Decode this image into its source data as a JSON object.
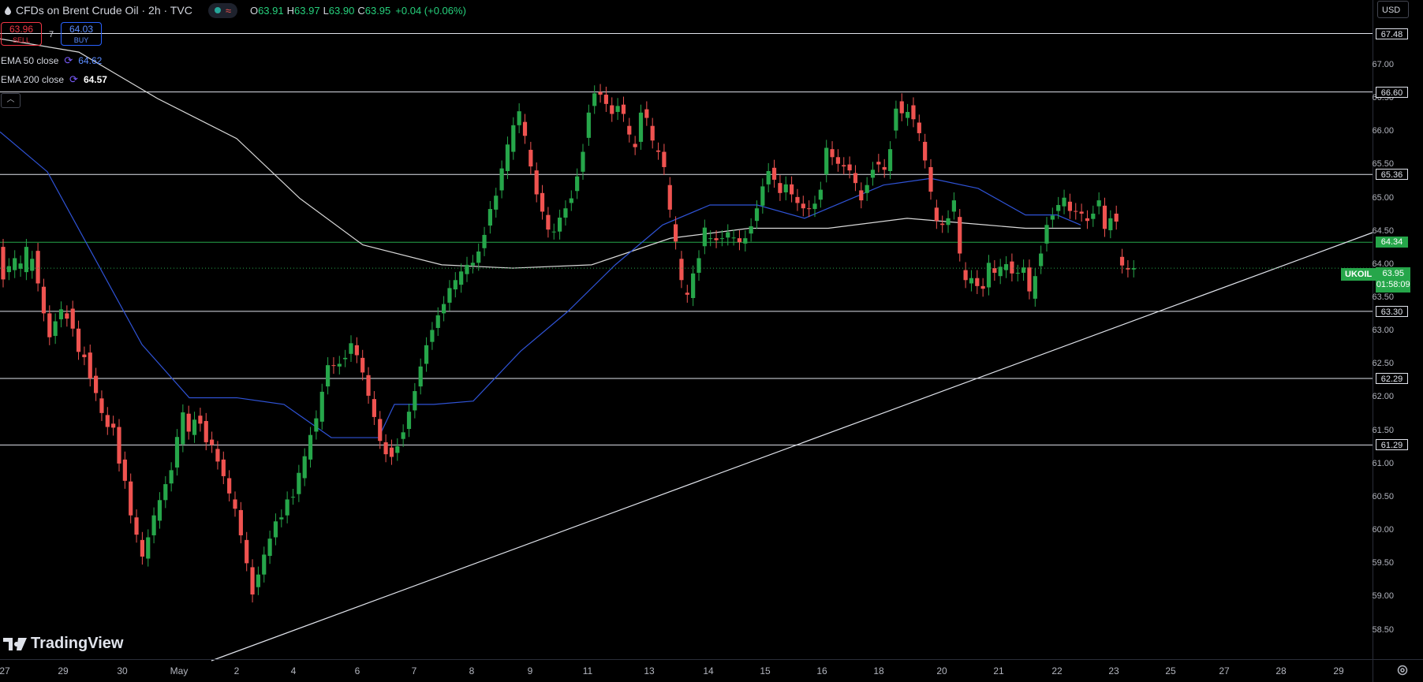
{
  "header": {
    "title": "CFDs on Brent Crude Oil · 2h · TVC",
    "ohlc": {
      "o_label": "O",
      "o": "63.91",
      "h_label": "H",
      "h": "63.97",
      "l_label": "L",
      "l": "63.90",
      "c_label": "C",
      "c": "63.95",
      "change": "+0.04 (+0.06%)"
    }
  },
  "trade": {
    "sell_price": "63.96",
    "sell_label": "SELL",
    "spread": "7",
    "buy_price": "64.03",
    "buy_label": "BUY"
  },
  "indicators": [
    {
      "label": "EMA 50 close",
      "value": "64.62"
    },
    {
      "label": "EMA 200 close",
      "value": "64.57"
    }
  ],
  "currency": "USD",
  "symbol_tag": {
    "symbol": "UKOIL",
    "price": "63.95",
    "countdown": "01:58:09"
  },
  "logo_text": "TradingView",
  "colors": {
    "up": "#26a64a",
    "down": "#ef5350",
    "ema50": "#2f53d6",
    "ema200": "#d9d9d9",
    "level": "#e0e3eb",
    "accent_level": "#26a64a"
  },
  "icons": [
    "drop-icon",
    "status-dot-icon",
    "wave-icon",
    "refresh-icon",
    "chevron-up-icon",
    "tradingview-logo-icon",
    "gear-icon"
  ],
  "chart_data": {
    "type": "candlestick",
    "interval": "2h",
    "y_ticks": [
      "58.50",
      "59.00",
      "59.50",
      "60.00",
      "60.50",
      "61.00",
      "61.50",
      "62.00",
      "62.50",
      "63.00",
      "63.50",
      "64.00",
      "64.50",
      "65.00",
      "65.50",
      "66.00",
      "66.50",
      "67.00"
    ],
    "x_ticks": [
      "27",
      "29",
      "30",
      "May",
      "2",
      "4",
      "6",
      "7",
      "8",
      "9",
      "11",
      "13",
      "14",
      "15",
      "16",
      "18",
      "20",
      "21",
      "22",
      "23",
      "25",
      "27",
      "28",
      "29"
    ],
    "ylim": [
      58.3,
      67.6
    ],
    "horizontal_levels": [
      {
        "value": "67.48",
        "style": "white"
      },
      {
        "value": "66.60",
        "style": "white"
      },
      {
        "value": "65.36",
        "style": "white"
      },
      {
        "value": "64.34",
        "style": "green"
      },
      {
        "value": "63.30",
        "style": "white"
      },
      {
        "value": "62.29",
        "style": "white"
      },
      {
        "value": "61.29",
        "style": "white"
      }
    ],
    "current_price": 63.95,
    "trendline": {
      "from": {
        "x": "May",
        "y": 58.3
      },
      "to": {
        "x": "29",
        "y": 64.5
      }
    },
    "candles": [
      [
        64.27,
        63.78
      ],
      [
        63.89,
        63.98
      ],
      [
        63.92,
        64.1
      ],
      [
        63.94,
        64.02
      ],
      [
        63.89,
        64.27
      ],
      [
        63.91,
        64.09
      ],
      [
        64.21,
        63.72
      ],
      [
        63.67,
        63.27
      ],
      [
        63.27,
        62.91
      ],
      [
        62.93,
        63.15
      ],
      [
        63.18,
        63.33
      ],
      [
        63.27,
        63.19
      ],
      [
        63.34,
        63.04
      ],
      [
        63.04,
        62.69
      ],
      [
        62.65,
        62.61
      ],
      [
        62.68,
        62.29
      ],
      [
        62.33,
        62.07
      ],
      [
        61.99,
        61.77
      ],
      [
        61.74,
        61.56
      ],
      [
        61.61,
        61.55
      ],
      [
        61.56,
        61.01
      ],
      [
        61.07,
        60.75
      ],
      [
        60.74,
        60.23
      ],
      [
        60.2,
        59.94
      ],
      [
        59.86,
        59.61
      ],
      [
        59.58,
        59.9
      ],
      [
        59.93,
        60.23
      ],
      [
        60.15,
        60.46
      ],
      [
        60.46,
        60.7
      ],
      [
        60.71,
        60.91
      ],
      [
        60.95,
        61.41
      ],
      [
        61.3,
        61.78
      ],
      [
        61.76,
        61.49
      ],
      [
        61.44,
        61.67
      ],
      [
        61.73,
        61.61
      ],
      [
        61.65,
        61.33
      ],
      [
        61.37,
        61.29
      ],
      [
        61.23,
        61.04
      ],
      [
        61.07,
        60.82
      ],
      [
        60.79,
        60.56
      ],
      [
        60.47,
        60.33
      ],
      [
        60.31,
        59.93
      ],
      [
        59.86,
        59.51
      ],
      [
        59.45,
        59.04
      ],
      [
        59.15,
        59.34
      ],
      [
        59.34,
        59.64
      ],
      [
        59.62,
        59.88
      ],
      [
        59.9,
        60.14
      ],
      [
        60.17,
        60.2
      ],
      [
        60.23,
        60.47
      ],
      [
        60.51,
        60.51
      ],
      [
        60.55,
        60.87
      ],
      [
        60.79,
        61.12
      ],
      [
        61.07,
        61.44
      ],
      [
        61.49,
        61.69
      ],
      [
        61.64,
        62.09
      ],
      [
        62.17,
        62.49
      ],
      [
        62.49,
        62.48
      ],
      [
        62.47,
        62.51
      ],
      [
        62.58,
        62.6
      ],
      [
        62.66,
        62.82
      ],
      [
        62.79,
        62.64
      ],
      [
        62.6,
        62.38
      ],
      [
        62.34,
        62.03
      ],
      [
        61.98,
        61.71
      ],
      [
        61.68,
        61.35
      ],
      [
        61.33,
        61.15
      ],
      [
        61.25,
        61.11
      ],
      [
        61.17,
        61.27
      ],
      [
        61.38,
        61.48
      ],
      [
        61.53,
        61.79
      ],
      [
        61.81,
        62.1
      ],
      [
        62.17,
        62.47
      ],
      [
        62.51,
        62.79
      ],
      [
        62.84,
        63.02
      ],
      [
        63.05,
        63.24
      ],
      [
        63.27,
        63.41
      ],
      [
        63.43,
        63.65
      ],
      [
        63.63,
        63.77
      ],
      [
        63.7,
        63.9
      ],
      [
        63.86,
        64.0
      ],
      [
        63.99,
        64.03
      ],
      [
        64.03,
        64.2
      ],
      [
        64.25,
        64.45
      ],
      [
        64.59,
        64.84
      ],
      [
        64.83,
        65.04
      ],
      [
        65.12,
        65.45
      ],
      [
        65.41,
        65.81
      ],
      [
        65.7,
        66.1
      ],
      [
        66.1,
        66.31
      ],
      [
        66.15,
        65.94
      ],
      [
        65.73,
        65.48
      ],
      [
        65.42,
        65.06
      ],
      [
        65.08,
        64.8
      ],
      [
        64.75,
        64.53
      ],
      [
        64.5,
        64.5
      ],
      [
        64.5,
        64.71
      ],
      [
        64.71,
        64.85
      ],
      [
        64.93,
        65.0
      ],
      [
        65.11,
        65.33
      ],
      [
        65.4,
        65.7
      ],
      [
        65.91,
        66.29
      ],
      [
        66.39,
        66.58
      ],
      [
        66.6,
        66.56
      ],
      [
        66.56,
        66.42
      ],
      [
        66.4,
        66.27
      ],
      [
        66.3,
        66.39
      ],
      [
        66.41,
        66.27
      ],
      [
        66.09,
        65.96
      ],
      [
        65.82,
        65.77
      ],
      [
        65.85,
        66.29
      ],
      [
        66.34,
        66.21
      ],
      [
        66.09,
        65.87
      ],
      [
        65.72,
        65.7
      ],
      [
        65.7,
        65.47
      ],
      [
        65.2,
        64.83
      ],
      [
        64.61,
        64.35
      ],
      [
        64.09,
        63.77
      ],
      [
        63.58,
        63.55
      ],
      [
        63.5,
        63.87
      ],
      [
        63.88,
        64.1
      ],
      [
        64.28,
        64.56
      ],
      [
        64.4,
        64.4
      ],
      [
        64.4,
        64.37
      ],
      [
        64.4,
        64.4
      ],
      [
        64.41,
        64.49
      ],
      [
        64.41,
        64.41
      ],
      [
        64.4,
        64.34
      ],
      [
        64.32,
        64.4
      ],
      [
        64.47,
        64.58
      ],
      [
        64.66,
        64.85
      ],
      [
        64.89,
        65.18
      ],
      [
        65.21,
        65.41
      ],
      [
        65.46,
        65.28
      ],
      [
        65.23,
        65.08
      ],
      [
        65.09,
        65.21
      ],
      [
        65.21,
        65.06
      ],
      [
        65.02,
        64.93
      ],
      [
        64.92,
        64.85
      ],
      [
        64.85,
        64.84
      ],
      [
        64.84,
        64.92
      ],
      [
        64.98,
        65.13
      ],
      [
        65.36,
        65.76
      ],
      [
        65.74,
        65.62
      ],
      [
        65.62,
        65.52
      ],
      [
        65.5,
        65.48
      ],
      [
        65.51,
        65.42
      ],
      [
        65.38,
        65.23
      ],
      [
        65.12,
        64.97
      ],
      [
        65.08,
        65.2
      ],
      [
        65.31,
        65.43
      ],
      [
        65.55,
        65.51
      ],
      [
        65.47,
        65.43
      ],
      [
        65.41,
        65.74
      ],
      [
        66.02,
        66.35
      ],
      [
        66.46,
        66.28
      ],
      [
        66.21,
        66.3
      ],
      [
        66.4,
        66.19
      ],
      [
        66.14,
        65.98
      ],
      [
        65.85,
        65.57
      ],
      [
        65.47,
        65.1
      ],
      [
        64.86,
        64.66
      ],
      [
        64.62,
        64.6
      ],
      [
        64.6,
        64.7
      ],
      [
        64.8,
        64.97
      ],
      [
        64.72,
        64.17
      ],
      [
        63.92,
        63.77
      ],
      [
        63.72,
        63.8
      ],
      [
        63.8,
        63.68
      ],
      [
        63.68,
        63.64
      ],
      [
        63.66,
        64.03
      ],
      [
        63.95,
        63.88
      ],
      [
        63.83,
        63.97
      ],
      [
        63.92,
        64.01
      ],
      [
        64.05,
        63.87
      ],
      [
        63.87,
        63.88
      ],
      [
        63.88,
        63.96
      ],
      [
        63.96,
        63.6
      ],
      [
        63.49,
        63.83
      ],
      [
        63.98,
        64.17
      ],
      [
        64.32,
        64.6
      ],
      [
        64.68,
        64.74
      ],
      [
        64.81,
        64.9
      ],
      [
        64.88,
        65.01
      ],
      [
        64.95,
        64.81
      ],
      [
        64.81,
        64.8
      ],
      [
        64.8,
        64.77
      ],
      [
        64.7,
        64.66
      ],
      [
        64.69,
        64.77
      ],
      [
        64.88,
        64.97
      ],
      [
        64.89,
        64.54
      ],
      [
        64.52,
        64.7
      ],
      [
        64.77,
        64.65
      ],
      [
        64.12,
        63.99
      ],
      [
        63.95,
        63.93
      ],
      [
        63.93,
        63.95
      ]
    ],
    "ema50": [
      [
        0,
        66.0
      ],
      [
        60,
        65.4
      ],
      [
        120,
        64.1
      ],
      [
        180,
        62.8
      ],
      [
        240,
        62.0
      ],
      [
        300,
        62.0
      ],
      [
        360,
        61.9
      ],
      [
        420,
        61.4
      ],
      [
        480,
        61.4
      ],
      [
        500,
        61.9
      ],
      [
        550,
        61.9
      ],
      [
        600,
        61.95
      ],
      [
        660,
        62.7
      ],
      [
        720,
        63.3
      ],
      [
        780,
        64.0
      ],
      [
        840,
        64.6
      ],
      [
        900,
        64.9
      ],
      [
        960,
        64.9
      ],
      [
        1020,
        64.7
      ],
      [
        1080,
        65.0
      ],
      [
        1120,
        65.2
      ],
      [
        1180,
        65.3
      ],
      [
        1240,
        65.15
      ],
      [
        1300,
        64.75
      ],
      [
        1340,
        64.75
      ],
      [
        1370,
        64.6
      ]
    ],
    "ema200": [
      [
        0,
        67.4
      ],
      [
        100,
        67.2
      ],
      [
        200,
        66.5
      ],
      [
        300,
        65.9
      ],
      [
        380,
        65.0
      ],
      [
        460,
        64.3
      ],
      [
        560,
        64.0
      ],
      [
        650,
        63.95
      ],
      [
        750,
        64.0
      ],
      [
        850,
        64.4
      ],
      [
        950,
        64.55
      ],
      [
        1050,
        64.55
      ],
      [
        1150,
        64.7
      ],
      [
        1250,
        64.6
      ],
      [
        1300,
        64.55
      ],
      [
        1370,
        64.55
      ]
    ]
  }
}
